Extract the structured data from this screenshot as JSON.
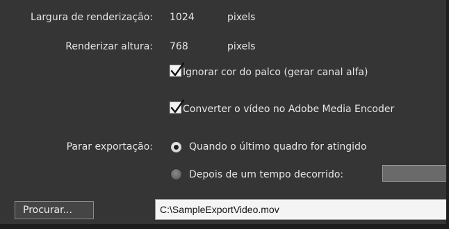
{
  "render_width": {
    "label": "Largura de renderização:",
    "value": "1024",
    "unit": "pixels"
  },
  "render_height": {
    "label": "Renderizar altura:",
    "value": "768",
    "unit": "pixels"
  },
  "ignore_stage_color": {
    "label": "Ignorar cor do palco (gerar canal alfa)",
    "checked": true
  },
  "convert_video": {
    "label": "Converter o vídeo no Adobe Media Encoder",
    "checked": true
  },
  "stop_export": {
    "label": "Parar exportação:",
    "options": [
      {
        "label": "Quando o último quadro for atingido",
        "selected": true
      },
      {
        "label": "Depois de um tempo decorrido:",
        "selected": false,
        "value": ""
      }
    ]
  },
  "browse_button": {
    "label": "Procurar..."
  },
  "output_path": {
    "value": "C:\\SampleExportVideo.mov"
  },
  "colors": {
    "panel_bg": "#353535",
    "text": "#e6e6e6",
    "field_bg": "#f4f4f4"
  }
}
